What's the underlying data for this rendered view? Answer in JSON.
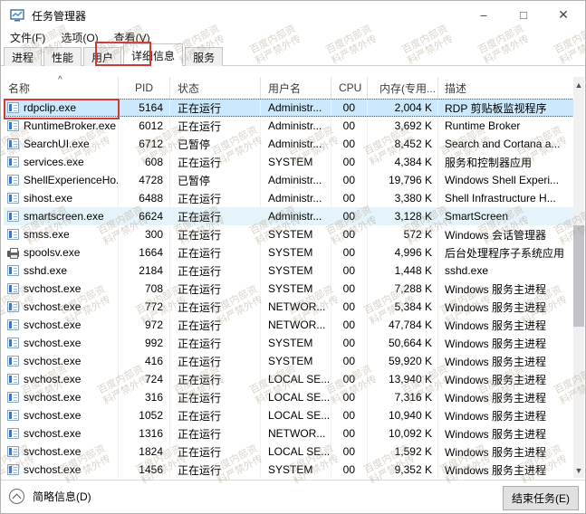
{
  "window": {
    "title": "任务管理器",
    "controls": {
      "minimize": "–",
      "maximize": "□",
      "close": "✕"
    }
  },
  "menu": {
    "items": [
      "文件(F)",
      "选项(O)",
      "查看(V)"
    ]
  },
  "tabs": {
    "items": [
      "进程",
      "性能",
      "用户",
      "详细信息",
      "服务"
    ],
    "active_index": 3
  },
  "table": {
    "sort_indicator": "^",
    "columns": [
      {
        "key": "name",
        "label": "名称"
      },
      {
        "key": "pid",
        "label": "PID"
      },
      {
        "key": "status",
        "label": "状态"
      },
      {
        "key": "user",
        "label": "用户名"
      },
      {
        "key": "cpu",
        "label": "CPU"
      },
      {
        "key": "memory",
        "label": "内存(专用..."
      },
      {
        "key": "desc",
        "label": "描述"
      }
    ],
    "rows": [
      {
        "name": "rdpclip.exe",
        "pid": "5164",
        "status": "正在运行",
        "user": "Administr...",
        "cpu": "00",
        "mem": "2,004 K",
        "desc": "RDP 剪贴板监视程序",
        "icon": "app-window-icon",
        "state": "selected"
      },
      {
        "name": "RuntimeBroker.exe",
        "pid": "6012",
        "status": "正在运行",
        "user": "Administr...",
        "cpu": "00",
        "mem": "3,692 K",
        "desc": "Runtime Broker",
        "icon": "app-window-icon",
        "state": ""
      },
      {
        "name": "SearchUI.exe",
        "pid": "6712",
        "status": "已暂停",
        "user": "Administr...",
        "cpu": "00",
        "mem": "8,452 K",
        "desc": "Search and Cortana a...",
        "icon": "app-window-icon",
        "state": ""
      },
      {
        "name": "services.exe",
        "pid": "608",
        "status": "正在运行",
        "user": "SYSTEM",
        "cpu": "00",
        "mem": "4,384 K",
        "desc": "服务和控制器应用",
        "icon": "app-window-icon",
        "state": ""
      },
      {
        "name": "ShellExperienceHo...",
        "pid": "4728",
        "status": "已暂停",
        "user": "Administr...",
        "cpu": "00",
        "mem": "19,796 K",
        "desc": "Windows Shell Experi...",
        "icon": "app-window-icon",
        "state": ""
      },
      {
        "name": "sihost.exe",
        "pid": "6488",
        "status": "正在运行",
        "user": "Administr...",
        "cpu": "00",
        "mem": "3,380 K",
        "desc": "Shell Infrastructure H...",
        "icon": "app-window-icon",
        "state": ""
      },
      {
        "name": "smartscreen.exe",
        "pid": "6624",
        "status": "正在运行",
        "user": "Administr...",
        "cpu": "00",
        "mem": "3,128 K",
        "desc": "SmartScreen",
        "icon": "app-window-icon",
        "state": "hover"
      },
      {
        "name": "smss.exe",
        "pid": "300",
        "status": "正在运行",
        "user": "SYSTEM",
        "cpu": "00",
        "mem": "572 K",
        "desc": "Windows 会话管理器",
        "icon": "app-window-icon",
        "state": ""
      },
      {
        "name": "spoolsv.exe",
        "pid": "1664",
        "status": "正在运行",
        "user": "SYSTEM",
        "cpu": "00",
        "mem": "4,996 K",
        "desc": "后台处理程序子系统应用",
        "icon": "printer-icon",
        "state": ""
      },
      {
        "name": "sshd.exe",
        "pid": "2184",
        "status": "正在运行",
        "user": "SYSTEM",
        "cpu": "00",
        "mem": "1,448 K",
        "desc": "sshd.exe",
        "icon": "app-window-icon",
        "state": ""
      },
      {
        "name": "svchost.exe",
        "pid": "708",
        "status": "正在运行",
        "user": "SYSTEM",
        "cpu": "00",
        "mem": "7,288 K",
        "desc": "Windows 服务主进程",
        "icon": "app-window-icon",
        "state": ""
      },
      {
        "name": "svchost.exe",
        "pid": "772",
        "status": "正在运行",
        "user": "NETWOR...",
        "cpu": "00",
        "mem": "5,384 K",
        "desc": "Windows 服务主进程",
        "icon": "app-window-icon",
        "state": ""
      },
      {
        "name": "svchost.exe",
        "pid": "972",
        "status": "正在运行",
        "user": "NETWOR...",
        "cpu": "00",
        "mem": "47,784 K",
        "desc": "Windows 服务主进程",
        "icon": "app-window-icon",
        "state": ""
      },
      {
        "name": "svchost.exe",
        "pid": "992",
        "status": "正在运行",
        "user": "SYSTEM",
        "cpu": "00",
        "mem": "50,664 K",
        "desc": "Windows 服务主进程",
        "icon": "app-window-icon",
        "state": ""
      },
      {
        "name": "svchost.exe",
        "pid": "416",
        "status": "正在运行",
        "user": "SYSTEM",
        "cpu": "00",
        "mem": "59,920 K",
        "desc": "Windows 服务主进程",
        "icon": "app-window-icon",
        "state": ""
      },
      {
        "name": "svchost.exe",
        "pid": "724",
        "status": "正在运行",
        "user": "LOCAL SE...",
        "cpu": "00",
        "mem": "13,940 K",
        "desc": "Windows 服务主进程",
        "icon": "app-window-icon",
        "state": ""
      },
      {
        "name": "svchost.exe",
        "pid": "316",
        "status": "正在运行",
        "user": "LOCAL SE...",
        "cpu": "00",
        "mem": "7,316 K",
        "desc": "Windows 服务主进程",
        "icon": "app-window-icon",
        "state": ""
      },
      {
        "name": "svchost.exe",
        "pid": "1052",
        "status": "正在运行",
        "user": "LOCAL SE...",
        "cpu": "00",
        "mem": "10,940 K",
        "desc": "Windows 服务主进程",
        "icon": "app-window-icon",
        "state": ""
      },
      {
        "name": "svchost.exe",
        "pid": "1316",
        "status": "正在运行",
        "user": "NETWOR...",
        "cpu": "00",
        "mem": "10,092 K",
        "desc": "Windows 服务主进程",
        "icon": "app-window-icon",
        "state": ""
      },
      {
        "name": "svchost.exe",
        "pid": "1824",
        "status": "正在运行",
        "user": "LOCAL SE...",
        "cpu": "00",
        "mem": "1,592 K",
        "desc": "Windows 服务主进程",
        "icon": "app-window-icon",
        "state": ""
      },
      {
        "name": "svchost.exe",
        "pid": "1456",
        "status": "正在运行",
        "user": "SYSTEM",
        "cpu": "00",
        "mem": "9,352 K",
        "desc": "Windows 服务主进程",
        "icon": "app-window-icon",
        "state": ""
      }
    ]
  },
  "scrollbar": {
    "up_glyph": "▲",
    "down_glyph": "▼"
  },
  "statusbar": {
    "toggle_label": "简略信息(D)",
    "end_task_label": "结束任务(E)"
  },
  "annotations": {
    "highlight_color": "#d03b36",
    "highlighted_tab": "详细信息",
    "highlighted_row": "rdpclip.exe"
  },
  "watermark": {
    "line1": "百度内部资",
    "line2": "料严禁外传"
  }
}
